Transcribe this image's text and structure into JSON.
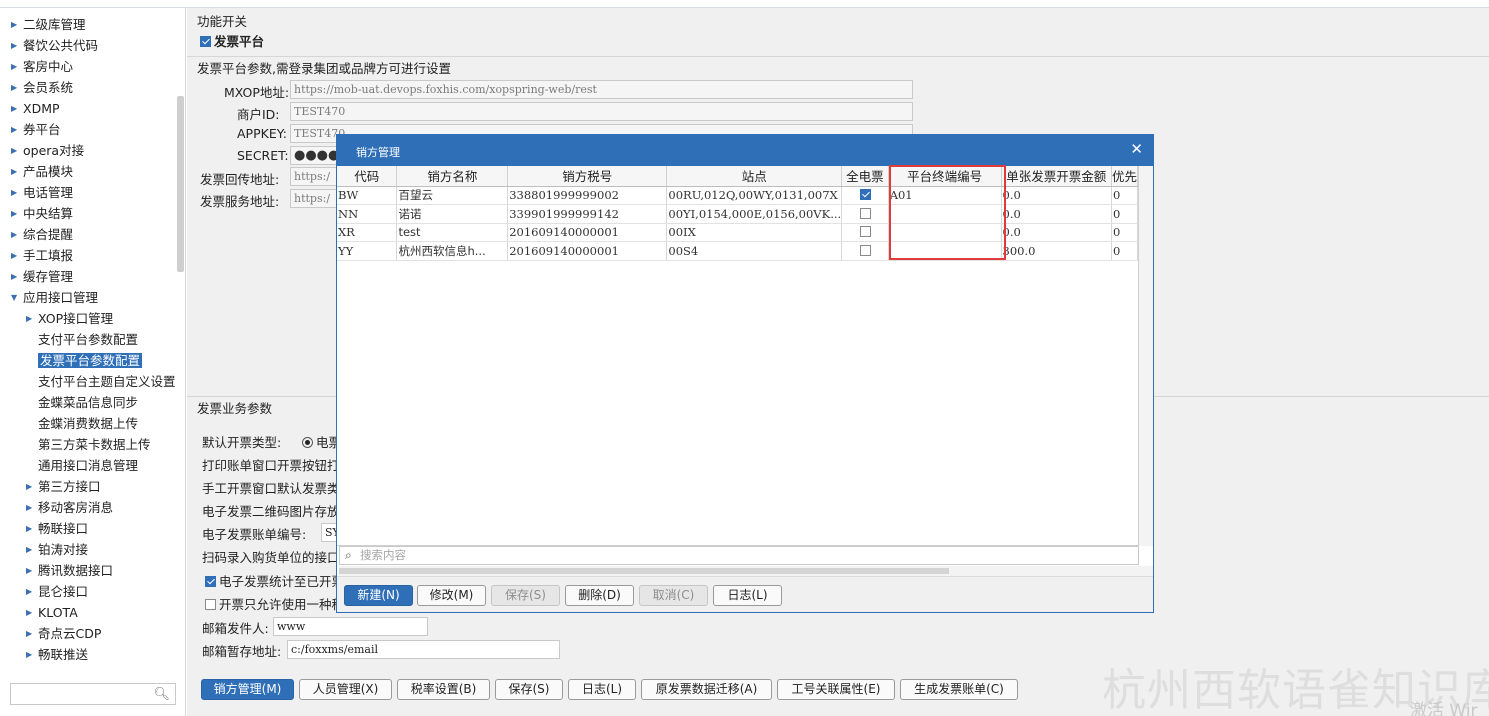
{
  "sidebar": {
    "items": [
      {
        "label": "二级库管理",
        "expander": "▶"
      },
      {
        "label": "餐饮公共代码",
        "expander": "▶"
      },
      {
        "label": "客房中心",
        "expander": "▶"
      },
      {
        "label": "会员系统",
        "expander": "▶"
      },
      {
        "label": "XDMP",
        "expander": "▶"
      },
      {
        "label": "券平台",
        "expander": "▶"
      },
      {
        "label": "opera对接",
        "expander": "▶"
      },
      {
        "label": "产品模块",
        "expander": "▶"
      },
      {
        "label": "电话管理",
        "expander": "▶"
      },
      {
        "label": "中央结算",
        "expander": "▶"
      },
      {
        "label": "综合提醒",
        "expander": "▶"
      },
      {
        "label": "手工填报",
        "expander": "▶"
      },
      {
        "label": "缓存管理",
        "expander": "▶"
      },
      {
        "label": "应用接口管理",
        "expander": "▼"
      },
      {
        "label": "XOP接口管理",
        "expander": "▶"
      },
      {
        "label": "支付平台参数配置",
        "expander": ""
      },
      {
        "label": "发票平台参数配置",
        "expander": ""
      },
      {
        "label": "支付平台主题自定义设置",
        "expander": ""
      },
      {
        "label": "金蝶菜品信息同步",
        "expander": ""
      },
      {
        "label": "金蝶消费数据上传",
        "expander": ""
      },
      {
        "label": "第三方菜卡数据上传",
        "expander": ""
      },
      {
        "label": "通用接口消息管理",
        "expander": ""
      },
      {
        "label": "第三方接口",
        "expander": "▶"
      },
      {
        "label": "移动客房消息",
        "expander": "▶"
      },
      {
        "label": "畅联接口",
        "expander": "▶"
      },
      {
        "label": "铂涛对接",
        "expander": "▶"
      },
      {
        "label": "腾讯数据接口",
        "expander": "▶"
      },
      {
        "label": "昆仑接口",
        "expander": "▶"
      },
      {
        "label": "KLOTA",
        "expander": "▶"
      },
      {
        "label": "奇点云CDP",
        "expander": "▶"
      },
      {
        "label": "畅联推送",
        "expander": "▶"
      }
    ],
    "search_placeholder": ""
  },
  "main": {
    "func_switch_title": "功能开关",
    "invoice_platform_label": "发票平台",
    "params_title": "发票平台参数,需登录集团或品牌方可进行设置",
    "fields": {
      "mxop_label": "MXOP地址:",
      "mxop_value": "https://mob-uat.devops.foxhis.com/xopspring-web/rest",
      "merchant_label": "商户ID:",
      "merchant_value": "TEST470",
      "appkey_label": "APPKEY:",
      "appkey_value": "TEST470",
      "secret_label": "SECRET:",
      "secret_value": "●●●●",
      "callback_label": "发票回传地址:",
      "callback_value": "https:/",
      "service_label": "发票服务地址:",
      "service_value": "https:/"
    },
    "biz_title": "发票业务参数",
    "biz": {
      "default_type_label": "默认开票类型:",
      "default_type_value": "电票",
      "print_btn_text": "打印账单窗口开票按钮打",
      "manual_text": "手工开票窗口默认发票类",
      "qrcode_text": "电子发票二维码图片存放",
      "bill_no_label": "电子发票账单编号:",
      "bill_no_value": "SY",
      "scan_text": "扫码录入购货单位的接口",
      "stat_text": "电子发票统计至已开票",
      "only_one_text": "开票只允许使用一种税",
      "mail_sender_label": "邮箱发件人:",
      "mail_sender_value": "www",
      "mail_temp_label": "邮箱暂存地址:",
      "mail_temp_value": "c:/foxxms/email"
    },
    "bottom_buttons": [
      "销方管理(M)",
      "人员管理(X)",
      "税率设置(B)",
      "保存(S)",
      "日志(L)",
      "原发票数据迁移(A)",
      "工号关联属性(E)",
      "生成发票账单(C)"
    ]
  },
  "dialog": {
    "title": "销方管理",
    "close": "✕",
    "columns": [
      "代码",
      "销方名称",
      "销方税号",
      "站点",
      "全电票",
      "平台终端编号",
      "单张发票开票金额",
      "优先"
    ],
    "rows": [
      {
        "code": "BW",
        "name": "百望云",
        "tax_no": "338801999999002",
        "site": "00RU,012Q,00WY,0131,007X",
        "full": true,
        "terminal": "A01",
        "amount": "0.0",
        "prio": "0"
      },
      {
        "code": "NN",
        "name": "诺诺",
        "tax_no": "339901999999142",
        "site": "00YI,0154,000E,0156,00VK...",
        "full": false,
        "terminal": "",
        "amount": "0.0",
        "prio": "0"
      },
      {
        "code": "XR",
        "name": "test",
        "tax_no": "201609140000001",
        "site": "00IX",
        "full": false,
        "terminal": "",
        "amount": "0.0",
        "prio": "0"
      },
      {
        "code": "YY",
        "name": "杭州西软信息h...",
        "tax_no": "201609140000001",
        "site": "00S4",
        "full": false,
        "terminal": "",
        "amount": "300.0",
        "prio": "0"
      }
    ],
    "search_placeholder": "搜索内容",
    "buttons": [
      {
        "label": "新建(N)",
        "state": "primary"
      },
      {
        "label": "修改(M)",
        "state": "normal"
      },
      {
        "label": "保存(S)",
        "state": "disabled"
      },
      {
        "label": "删除(D)",
        "state": "normal"
      },
      {
        "label": "取消(C)",
        "state": "disabled"
      },
      {
        "label": "日志(L)",
        "state": "normal"
      }
    ]
  },
  "watermark": "杭州西软语雀知识库",
  "activate_text": "激活 Wir",
  "colors": {
    "accent": "#2f6fb8",
    "highlight": "#e03a3a"
  }
}
